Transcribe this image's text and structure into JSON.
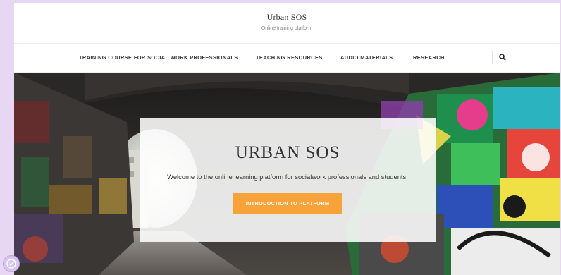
{
  "header": {
    "site_title": "Urban SOS",
    "tagline": "Online training platform"
  },
  "nav": {
    "items": [
      {
        "label": "TRAINING COURSE FOR SOCIAL WORK PROFESSIONALS"
      },
      {
        "label": "TEACHING RESOURCES"
      },
      {
        "label": "AUDIO MATERIALS"
      },
      {
        "label": "RESEARCH"
      }
    ],
    "search_icon": "search-icon"
  },
  "hero": {
    "title": "URBAN SOS",
    "text": "Welcome to the online learning platform for socialwork professionals and students!",
    "cta_label": "INTRODUCTION TO PLATFORM",
    "image": "graffiti-tunnel-photo"
  },
  "colors": {
    "accent": "#f7a33a",
    "page_background": "#e8d7f3"
  },
  "badge_icon": "check-badge-icon"
}
